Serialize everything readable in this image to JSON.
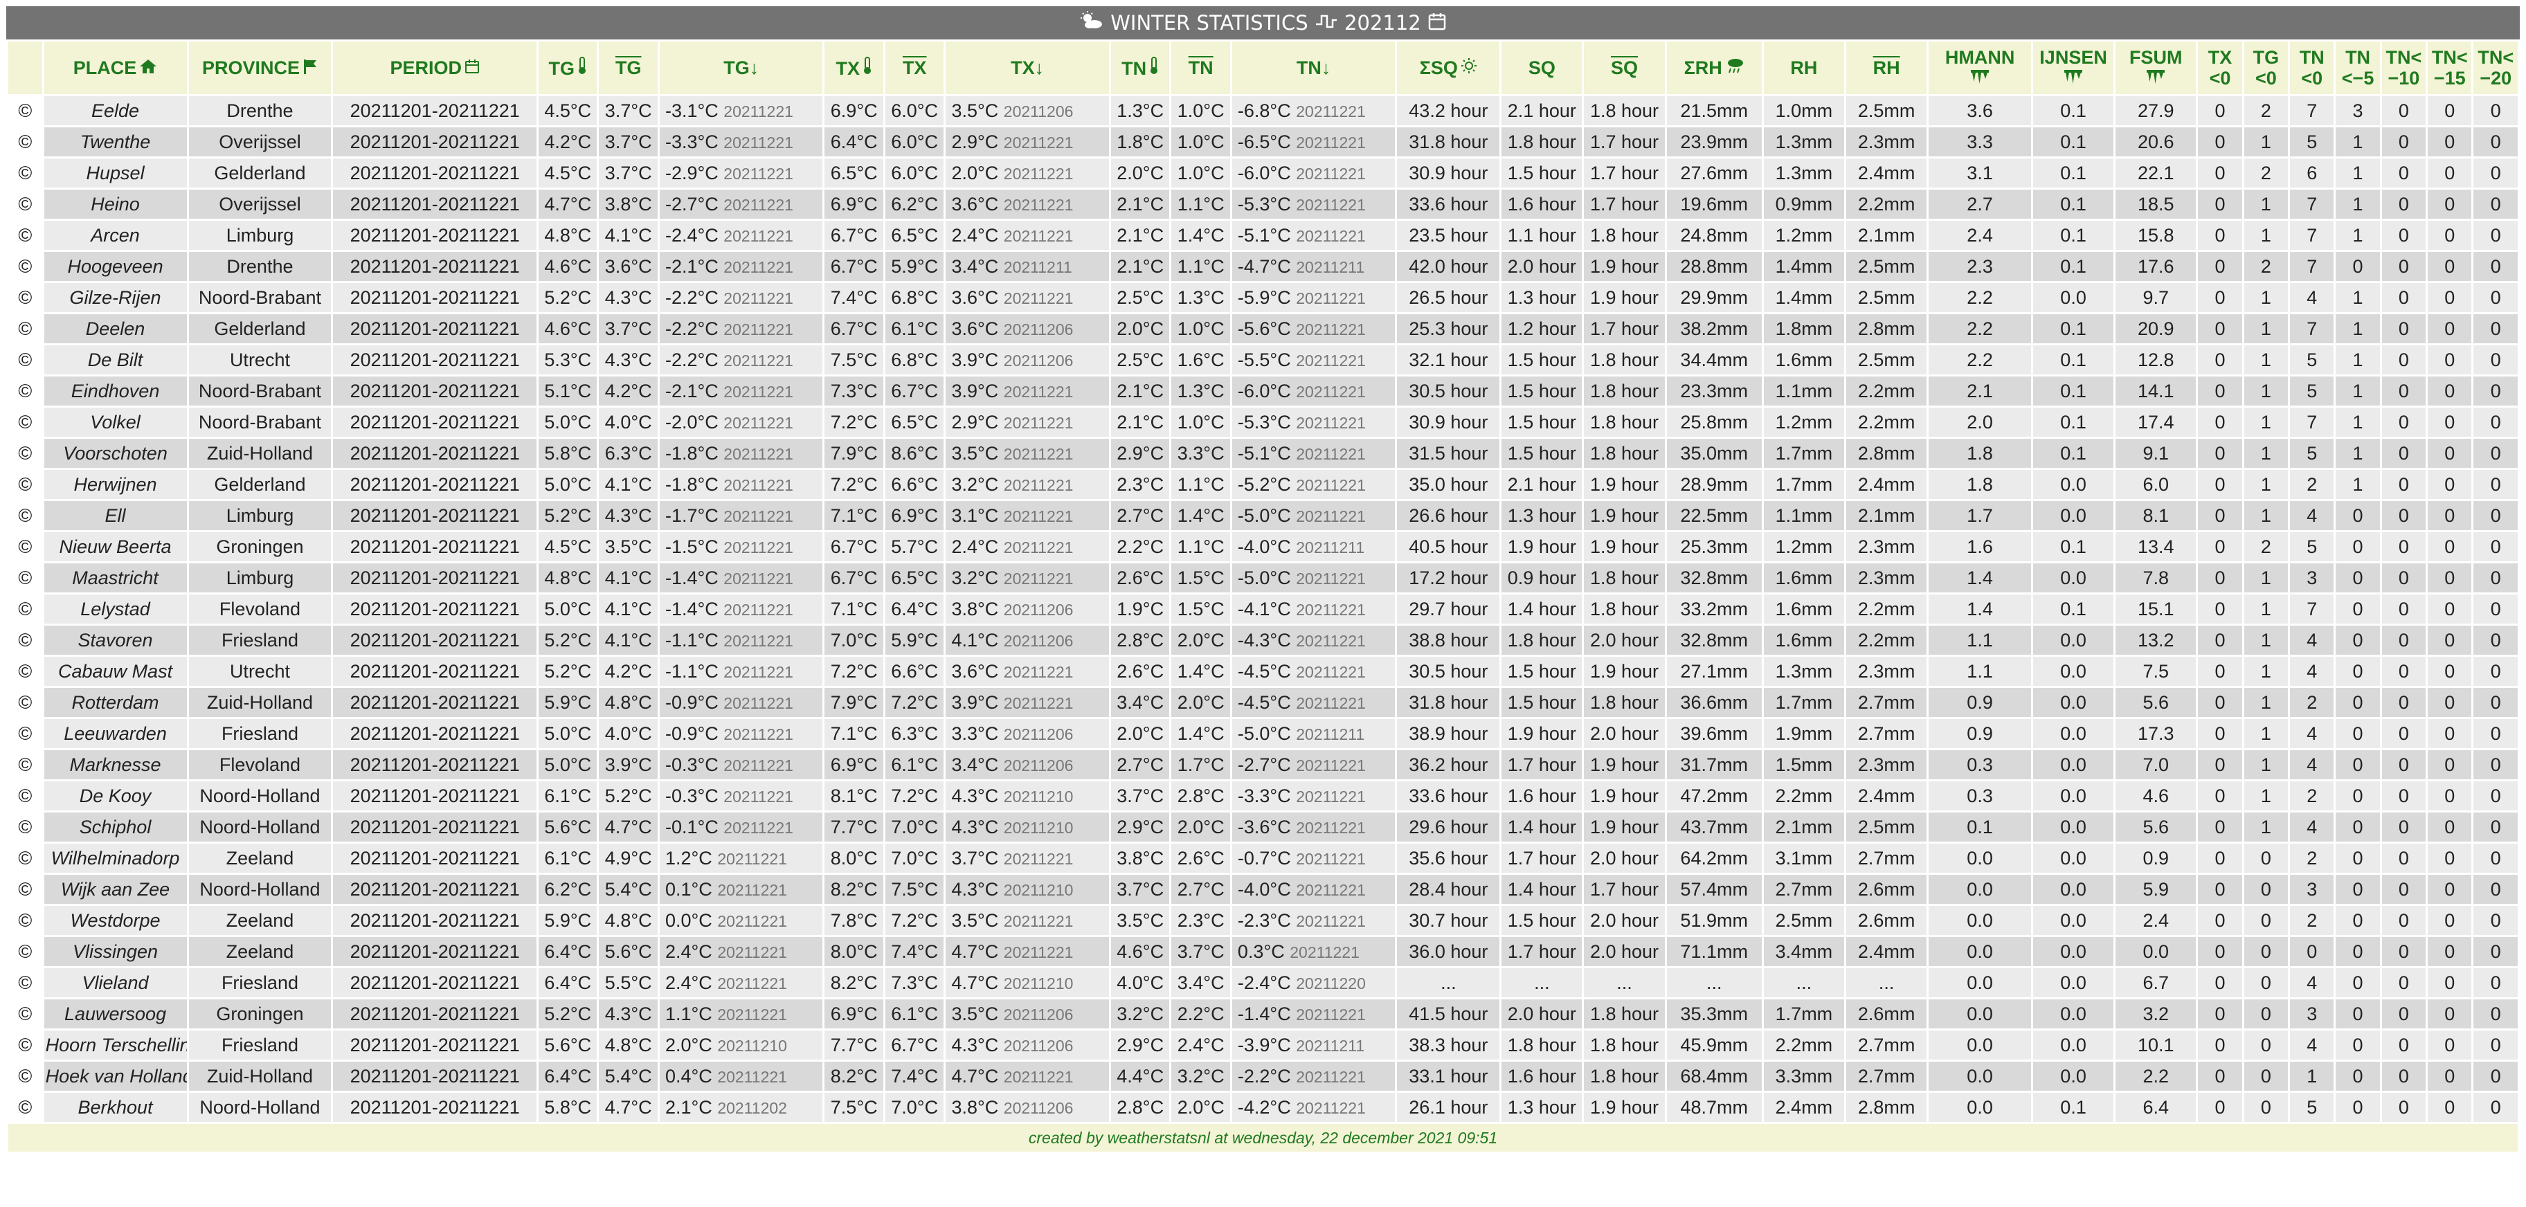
{
  "title": {
    "text": "WINTER STATISTICS",
    "period": "202112",
    "icons": [
      "sun-cloud-icon",
      "step-graph-icon",
      "calendar-icon"
    ]
  },
  "columns": [
    {
      "key": "c",
      "label": ""
    },
    {
      "key": "place",
      "label": "PLACE",
      "icon": "home-icon"
    },
    {
      "key": "province",
      "label": "PROVINCE",
      "icon": "flag-icon"
    },
    {
      "key": "period",
      "label": "PERIOD",
      "icon": "calendar-icon"
    },
    {
      "key": "tg",
      "label": "TG",
      "icon": "thermometer-icon"
    },
    {
      "key": "tg_avg",
      "label": "TG",
      "overline": true
    },
    {
      "key": "tg_low",
      "label": "TG↓"
    },
    {
      "key": "tx",
      "label": "TX",
      "icon": "thermometer-icon"
    },
    {
      "key": "tx_avg",
      "label": "TX",
      "overline": true
    },
    {
      "key": "tx_low",
      "label": "TX↓"
    },
    {
      "key": "tn",
      "label": "TN",
      "icon": "thermometer-icon"
    },
    {
      "key": "tn_avg",
      "label": "TN",
      "overline": true
    },
    {
      "key": "tn_low",
      "label": "TN↓"
    },
    {
      "key": "sq_sum",
      "label": "ΣSQ",
      "icon": "sun-icon"
    },
    {
      "key": "sq",
      "label": "SQ"
    },
    {
      "key": "sq_avg",
      "label": "SQ",
      "overline": true
    },
    {
      "key": "rh_sum",
      "label": "ΣRH",
      "icon": "rain-icon"
    },
    {
      "key": "rh",
      "label": "RH"
    },
    {
      "key": "rh_avg",
      "label": "RH",
      "overline": true
    },
    {
      "key": "hmann",
      "label": "HMANN",
      "icon": "icicle-icon"
    },
    {
      "key": "ijnsen",
      "label": "IJNSEN",
      "icon": "icicle-icon"
    },
    {
      "key": "fsum",
      "label": "FSUM",
      "icon": "icicle-icon"
    },
    {
      "key": "tx0",
      "label": "TX <0"
    },
    {
      "key": "tg0",
      "label": "TG <0"
    },
    {
      "key": "tn0",
      "label": "TN <0"
    },
    {
      "key": "tn5",
      "label": "TN <−5"
    },
    {
      "key": "tn10",
      "label": "TN< −10"
    },
    {
      "key": "tn15",
      "label": "TN< −15"
    },
    {
      "key": "tn20",
      "label": "TN< −20"
    }
  ],
  "rows": [
    [
      "©",
      "Eelde",
      "Drenthe",
      "20211201-20211221",
      "4.5°C",
      "3.7°C",
      "-3.1°C|20211221",
      "6.9°C",
      "6.0°C",
      "3.5°C|20211206",
      "1.3°C",
      "1.0°C",
      "-6.8°C|20211221",
      "43.2 hour",
      "2.1 hour",
      "1.8 hour",
      "21.5mm",
      "1.0mm",
      "2.5mm",
      "3.6",
      "0.1",
      "27.9",
      "0",
      "2",
      "7",
      "3",
      "0",
      "0",
      "0"
    ],
    [
      "©",
      "Twenthe",
      "Overijssel",
      "20211201-20211221",
      "4.2°C",
      "3.7°C",
      "-3.3°C|20211221",
      "6.4°C",
      "6.0°C",
      "2.9°C|20211221",
      "1.8°C",
      "1.0°C",
      "-6.5°C|20211221",
      "31.8 hour",
      "1.8 hour",
      "1.7 hour",
      "23.9mm",
      "1.3mm",
      "2.3mm",
      "3.3",
      "0.1",
      "20.6",
      "0",
      "1",
      "5",
      "1",
      "0",
      "0",
      "0"
    ],
    [
      "©",
      "Hupsel",
      "Gelderland",
      "20211201-20211221",
      "4.5°C",
      "3.7°C",
      "-2.9°C|20211221",
      "6.5°C",
      "6.0°C",
      "2.0°C|20211221",
      "2.0°C",
      "1.0°C",
      "-6.0°C|20211221",
      "30.9 hour",
      "1.5 hour",
      "1.7 hour",
      "27.6mm",
      "1.3mm",
      "2.4mm",
      "3.1",
      "0.1",
      "22.1",
      "0",
      "2",
      "6",
      "1",
      "0",
      "0",
      "0"
    ],
    [
      "©",
      "Heino",
      "Overijssel",
      "20211201-20211221",
      "4.7°C",
      "3.8°C",
      "-2.7°C|20211221",
      "6.9°C",
      "6.2°C",
      "3.6°C|20211221",
      "2.1°C",
      "1.1°C",
      "-5.3°C|20211221",
      "33.6 hour",
      "1.6 hour",
      "1.7 hour",
      "19.6mm",
      "0.9mm",
      "2.2mm",
      "2.7",
      "0.1",
      "18.5",
      "0",
      "1",
      "7",
      "1",
      "0",
      "0",
      "0"
    ],
    [
      "©",
      "Arcen",
      "Limburg",
      "20211201-20211221",
      "4.8°C",
      "4.1°C",
      "-2.4°C|20211221",
      "6.7°C",
      "6.5°C",
      "2.4°C|20211221",
      "2.1°C",
      "1.4°C",
      "-5.1°C|20211221",
      "23.5 hour",
      "1.1 hour",
      "1.8 hour",
      "24.8mm",
      "1.2mm",
      "2.1mm",
      "2.4",
      "0.1",
      "15.8",
      "0",
      "1",
      "7",
      "1",
      "0",
      "0",
      "0"
    ],
    [
      "©",
      "Hoogeveen",
      "Drenthe",
      "20211201-20211221",
      "4.6°C",
      "3.6°C",
      "-2.1°C|20211221",
      "6.7°C",
      "5.9°C",
      "3.4°C|20211211",
      "2.1°C",
      "1.1°C",
      "-4.7°C|20211211",
      "42.0 hour",
      "2.0 hour",
      "1.9 hour",
      "28.8mm",
      "1.4mm",
      "2.5mm",
      "2.3",
      "0.1",
      "17.6",
      "0",
      "2",
      "7",
      "0",
      "0",
      "0",
      "0"
    ],
    [
      "©",
      "Gilze-Rijen",
      "Noord-Brabant",
      "20211201-20211221",
      "5.2°C",
      "4.3°C",
      "-2.2°C|20211221",
      "7.4°C",
      "6.8°C",
      "3.6°C|20211221",
      "2.5°C",
      "1.3°C",
      "-5.9°C|20211221",
      "26.5 hour",
      "1.3 hour",
      "1.9 hour",
      "29.9mm",
      "1.4mm",
      "2.5mm",
      "2.2",
      "0.0",
      "9.7",
      "0",
      "1",
      "4",
      "1",
      "0",
      "0",
      "0"
    ],
    [
      "©",
      "Deelen",
      "Gelderland",
      "20211201-20211221",
      "4.6°C",
      "3.7°C",
      "-2.2°C|20211221",
      "6.7°C",
      "6.1°C",
      "3.6°C|20211206",
      "2.0°C",
      "1.0°C",
      "-5.6°C|20211221",
      "25.3 hour",
      "1.2 hour",
      "1.7 hour",
      "38.2mm",
      "1.8mm",
      "2.8mm",
      "2.2",
      "0.1",
      "20.9",
      "0",
      "1",
      "7",
      "1",
      "0",
      "0",
      "0"
    ],
    [
      "©",
      "De Bilt",
      "Utrecht",
      "20211201-20211221",
      "5.3°C",
      "4.3°C",
      "-2.2°C|20211221",
      "7.5°C",
      "6.8°C",
      "3.9°C|20211206",
      "2.5°C",
      "1.6°C",
      "-5.5°C|20211221",
      "32.1 hour",
      "1.5 hour",
      "1.8 hour",
      "34.4mm",
      "1.6mm",
      "2.5mm",
      "2.2",
      "0.1",
      "12.8",
      "0",
      "1",
      "5",
      "1",
      "0",
      "0",
      "0"
    ],
    [
      "©",
      "Eindhoven",
      "Noord-Brabant",
      "20211201-20211221",
      "5.1°C",
      "4.2°C",
      "-2.1°C|20211221",
      "7.3°C",
      "6.7°C",
      "3.9°C|20211221",
      "2.1°C",
      "1.3°C",
      "-6.0°C|20211221",
      "30.5 hour",
      "1.5 hour",
      "1.8 hour",
      "23.3mm",
      "1.1mm",
      "2.2mm",
      "2.1",
      "0.1",
      "14.1",
      "0",
      "1",
      "5",
      "1",
      "0",
      "0",
      "0"
    ],
    [
      "©",
      "Volkel",
      "Noord-Brabant",
      "20211201-20211221",
      "5.0°C",
      "4.0°C",
      "-2.0°C|20211221",
      "7.2°C",
      "6.5°C",
      "2.9°C|20211221",
      "2.1°C",
      "1.0°C",
      "-5.3°C|20211221",
      "30.9 hour",
      "1.5 hour",
      "1.8 hour",
      "25.8mm",
      "1.2mm",
      "2.2mm",
      "2.0",
      "0.1",
      "17.4",
      "0",
      "1",
      "7",
      "1",
      "0",
      "0",
      "0"
    ],
    [
      "©",
      "Voorschoten",
      "Zuid-Holland",
      "20211201-20211221",
      "5.8°C",
      "6.3°C",
      "-1.8°C|20211221",
      "7.9°C",
      "8.6°C",
      "3.5°C|20211221",
      "2.9°C",
      "3.3°C",
      "-5.1°C|20211221",
      "31.5 hour",
      "1.5 hour",
      "1.8 hour",
      "35.0mm",
      "1.7mm",
      "2.8mm",
      "1.8",
      "0.1",
      "9.1",
      "0",
      "1",
      "5",
      "1",
      "0",
      "0",
      "0"
    ],
    [
      "©",
      "Herwijnen",
      "Gelderland",
      "20211201-20211221",
      "5.0°C",
      "4.1°C",
      "-1.8°C|20211221",
      "7.2°C",
      "6.6°C",
      "3.2°C|20211221",
      "2.3°C",
      "1.1°C",
      "-5.2°C|20211221",
      "35.0 hour",
      "2.1 hour",
      "1.9 hour",
      "28.9mm",
      "1.7mm",
      "2.4mm",
      "1.8",
      "0.0",
      "6.0",
      "0",
      "1",
      "2",
      "1",
      "0",
      "0",
      "0"
    ],
    [
      "©",
      "Ell",
      "Limburg",
      "20211201-20211221",
      "5.2°C",
      "4.3°C",
      "-1.7°C|20211221",
      "7.1°C",
      "6.9°C",
      "3.1°C|20211221",
      "2.7°C",
      "1.4°C",
      "-5.0°C|20211221",
      "26.6 hour",
      "1.3 hour",
      "1.9 hour",
      "22.5mm",
      "1.1mm",
      "2.1mm",
      "1.7",
      "0.0",
      "8.1",
      "0",
      "1",
      "4",
      "0",
      "0",
      "0",
      "0"
    ],
    [
      "©",
      "Nieuw Beerta",
      "Groningen",
      "20211201-20211221",
      "4.5°C",
      "3.5°C",
      "-1.5°C|20211221",
      "6.7°C",
      "5.7°C",
      "2.4°C|20211221",
      "2.2°C",
      "1.1°C",
      "-4.0°C|20211211",
      "40.5 hour",
      "1.9 hour",
      "1.9 hour",
      "25.3mm",
      "1.2mm",
      "2.3mm",
      "1.6",
      "0.1",
      "13.4",
      "0",
      "2",
      "5",
      "0",
      "0",
      "0",
      "0"
    ],
    [
      "©",
      "Maastricht",
      "Limburg",
      "20211201-20211221",
      "4.8°C",
      "4.1°C",
      "-1.4°C|20211221",
      "6.7°C",
      "6.5°C",
      "3.2°C|20211221",
      "2.6°C",
      "1.5°C",
      "-5.0°C|20211221",
      "17.2 hour",
      "0.9 hour",
      "1.8 hour",
      "32.8mm",
      "1.6mm",
      "2.3mm",
      "1.4",
      "0.0",
      "7.8",
      "0",
      "1",
      "3",
      "0",
      "0",
      "0",
      "0"
    ],
    [
      "©",
      "Lelystad",
      "Flevoland",
      "20211201-20211221",
      "5.0°C",
      "4.1°C",
      "-1.4°C|20211221",
      "7.1°C",
      "6.4°C",
      "3.8°C|20211206",
      "1.9°C",
      "1.5°C",
      "-4.1°C|20211221",
      "29.7 hour",
      "1.4 hour",
      "1.8 hour",
      "33.2mm",
      "1.6mm",
      "2.2mm",
      "1.4",
      "0.1",
      "15.1",
      "0",
      "1",
      "7",
      "0",
      "0",
      "0",
      "0"
    ],
    [
      "©",
      "Stavoren",
      "Friesland",
      "20211201-20211221",
      "5.2°C",
      "4.1°C",
      "-1.1°C|20211221",
      "7.0°C",
      "5.9°C",
      "4.1°C|20211206",
      "2.8°C",
      "2.0°C",
      "-4.3°C|20211221",
      "38.8 hour",
      "1.8 hour",
      "2.0 hour",
      "32.8mm",
      "1.6mm",
      "2.2mm",
      "1.1",
      "0.0",
      "13.2",
      "0",
      "1",
      "4",
      "0",
      "0",
      "0",
      "0"
    ],
    [
      "©",
      "Cabauw Mast",
      "Utrecht",
      "20211201-20211221",
      "5.2°C",
      "4.2°C",
      "-1.1°C|20211221",
      "7.2°C",
      "6.6°C",
      "3.6°C|20211221",
      "2.6°C",
      "1.4°C",
      "-4.5°C|20211221",
      "30.5 hour",
      "1.5 hour",
      "1.9 hour",
      "27.1mm",
      "1.3mm",
      "2.3mm",
      "1.1",
      "0.0",
      "7.5",
      "0",
      "1",
      "4",
      "0",
      "0",
      "0",
      "0"
    ],
    [
      "©",
      "Rotterdam",
      "Zuid-Holland",
      "20211201-20211221",
      "5.9°C",
      "4.8°C",
      "-0.9°C|20211221",
      "7.9°C",
      "7.2°C",
      "3.9°C|20211221",
      "3.4°C",
      "2.0°C",
      "-4.5°C|20211221",
      "31.8 hour",
      "1.5 hour",
      "1.8 hour",
      "36.6mm",
      "1.7mm",
      "2.7mm",
      "0.9",
      "0.0",
      "5.6",
      "0",
      "1",
      "2",
      "0",
      "0",
      "0",
      "0"
    ],
    [
      "©",
      "Leeuwarden",
      "Friesland",
      "20211201-20211221",
      "5.0°C",
      "4.0°C",
      "-0.9°C|20211221",
      "7.1°C",
      "6.3°C",
      "3.3°C|20211206",
      "2.0°C",
      "1.4°C",
      "-5.0°C|20211211",
      "38.9 hour",
      "1.9 hour",
      "2.0 hour",
      "39.6mm",
      "1.9mm",
      "2.7mm",
      "0.9",
      "0.0",
      "17.3",
      "0",
      "1",
      "4",
      "0",
      "0",
      "0",
      "0"
    ],
    [
      "©",
      "Marknesse",
      "Flevoland",
      "20211201-20211221",
      "5.0°C",
      "3.9°C",
      "-0.3°C|20211221",
      "6.9°C",
      "6.1°C",
      "3.4°C|20211206",
      "2.7°C",
      "1.7°C",
      "-2.7°C|20211221",
      "36.2 hour",
      "1.7 hour",
      "1.9 hour",
      "31.7mm",
      "1.5mm",
      "2.3mm",
      "0.3",
      "0.0",
      "7.0",
      "0",
      "1",
      "4",
      "0",
      "0",
      "0",
      "0"
    ],
    [
      "©",
      "De Kooy",
      "Noord-Holland",
      "20211201-20211221",
      "6.1°C",
      "5.2°C",
      "-0.3°C|20211221",
      "8.1°C",
      "7.2°C",
      "4.3°C|20211210",
      "3.7°C",
      "2.8°C",
      "-3.3°C|20211221",
      "33.6 hour",
      "1.6 hour",
      "1.9 hour",
      "47.2mm",
      "2.2mm",
      "2.4mm",
      "0.3",
      "0.0",
      "4.6",
      "0",
      "1",
      "2",
      "0",
      "0",
      "0",
      "0"
    ],
    [
      "©",
      "Schiphol",
      "Noord-Holland",
      "20211201-20211221",
      "5.6°C",
      "4.7°C",
      "-0.1°C|20211221",
      "7.7°C",
      "7.0°C",
      "4.3°C|20211210",
      "2.9°C",
      "2.0°C",
      "-3.6°C|20211221",
      "29.6 hour",
      "1.4 hour",
      "1.9 hour",
      "43.7mm",
      "2.1mm",
      "2.5mm",
      "0.1",
      "0.0",
      "5.6",
      "0",
      "1",
      "4",
      "0",
      "0",
      "0",
      "0"
    ],
    [
      "©",
      "Wilhelminadorp",
      "Zeeland",
      "20211201-20211221",
      "6.1°C",
      "4.9°C",
      "1.2°C|20211221",
      "8.0°C",
      "7.0°C",
      "3.7°C|20211221",
      "3.8°C",
      "2.6°C",
      "-0.7°C|20211221",
      "35.6 hour",
      "1.7 hour",
      "2.0 hour",
      "64.2mm",
      "3.1mm",
      "2.7mm",
      "0.0",
      "0.0",
      "0.9",
      "0",
      "0",
      "2",
      "0",
      "0",
      "0",
      "0"
    ],
    [
      "©",
      "Wijk aan Zee",
      "Noord-Holland",
      "20211201-20211221",
      "6.2°C",
      "5.4°C",
      "0.1°C|20211221",
      "8.2°C",
      "7.5°C",
      "4.3°C|20211210",
      "3.7°C",
      "2.7°C",
      "-4.0°C|20211221",
      "28.4 hour",
      "1.4 hour",
      "1.7 hour",
      "57.4mm",
      "2.7mm",
      "2.6mm",
      "0.0",
      "0.0",
      "5.9",
      "0",
      "0",
      "3",
      "0",
      "0",
      "0",
      "0"
    ],
    [
      "©",
      "Westdorpe",
      "Zeeland",
      "20211201-20211221",
      "5.9°C",
      "4.8°C",
      "0.0°C|20211221",
      "7.8°C",
      "7.2°C",
      "3.5°C|20211221",
      "3.5°C",
      "2.3°C",
      "-2.3°C|20211221",
      "30.7 hour",
      "1.5 hour",
      "2.0 hour",
      "51.9mm",
      "2.5mm",
      "2.6mm",
      "0.0",
      "0.0",
      "2.4",
      "0",
      "0",
      "2",
      "0",
      "0",
      "0",
      "0"
    ],
    [
      "©",
      "Vlissingen",
      "Zeeland",
      "20211201-20211221",
      "6.4°C",
      "5.6°C",
      "2.4°C|20211221",
      "8.0°C",
      "7.4°C",
      "4.7°C|20211221",
      "4.6°C",
      "3.7°C",
      "0.3°C|20211221",
      "36.0 hour",
      "1.7 hour",
      "2.0 hour",
      "71.1mm",
      "3.4mm",
      "2.4mm",
      "0.0",
      "0.0",
      "0.0",
      "0",
      "0",
      "0",
      "0",
      "0",
      "0",
      "0"
    ],
    [
      "©",
      "Vlieland",
      "Friesland",
      "20211201-20211221",
      "6.4°C",
      "5.5°C",
      "2.4°C|20211221",
      "8.2°C",
      "7.3°C",
      "4.7°C|20211210",
      "4.0°C",
      "3.4°C",
      "-2.4°C|20211220",
      "...",
      "...",
      "...",
      "...",
      "...",
      "...",
      "0.0",
      "0.0",
      "6.7",
      "0",
      "0",
      "4",
      "0",
      "0",
      "0",
      "0"
    ],
    [
      "©",
      "Lauwersoog",
      "Groningen",
      "20211201-20211221",
      "5.2°C",
      "4.3°C",
      "1.1°C|20211221",
      "6.9°C",
      "6.1°C",
      "3.5°C|20211206",
      "3.2°C",
      "2.2°C",
      "-1.4°C|20211221",
      "41.5 hour",
      "2.0 hour",
      "1.8 hour",
      "35.3mm",
      "1.7mm",
      "2.6mm",
      "0.0",
      "0.0",
      "3.2",
      "0",
      "0",
      "3",
      "0",
      "0",
      "0",
      "0"
    ],
    [
      "©",
      "Hoorn Terschelling",
      "Friesland",
      "20211201-20211221",
      "5.6°C",
      "4.8°C",
      "2.0°C|20211210",
      "7.7°C",
      "6.7°C",
      "4.3°C|20211206",
      "2.9°C",
      "2.4°C",
      "-3.9°C|20211211",
      "38.3 hour",
      "1.8 hour",
      "1.8 hour",
      "45.9mm",
      "2.2mm",
      "2.7mm",
      "0.0",
      "0.0",
      "10.1",
      "0",
      "0",
      "4",
      "0",
      "0",
      "0",
      "0"
    ],
    [
      "©",
      "Hoek van Holland",
      "Zuid-Holland",
      "20211201-20211221",
      "6.4°C",
      "5.4°C",
      "0.4°C|20211221",
      "8.2°C",
      "7.4°C",
      "4.7°C|20211221",
      "4.4°C",
      "3.2°C",
      "-2.2°C|20211221",
      "33.1 hour",
      "1.6 hour",
      "1.8 hour",
      "68.4mm",
      "3.3mm",
      "2.7mm",
      "0.0",
      "0.0",
      "2.2",
      "0",
      "0",
      "1",
      "0",
      "0",
      "0",
      "0"
    ],
    [
      "©",
      "Berkhout",
      "Noord-Holland",
      "20211201-20211221",
      "5.8°C",
      "4.7°C",
      "2.1°C|20211202",
      "7.5°C",
      "7.0°C",
      "3.8°C|20211206",
      "2.8°C",
      "2.0°C",
      "-4.2°C|20211221",
      "26.1 hour",
      "1.3 hour",
      "1.9 hour",
      "48.7mm",
      "2.4mm",
      "2.8mm",
      "0.0",
      "0.1",
      "6.4",
      "0",
      "0",
      "5",
      "0",
      "0",
      "0",
      "0"
    ]
  ],
  "footer": "created by weatherstatsnl at wednesday, 22 december 2021 09:51",
  "colors": {
    "header_bg": "#f3f3d6",
    "header_text": "#1f7a1f",
    "title_bg": "#737373",
    "row_odd": "#ebebeb",
    "row_even": "#d9d9d9"
  }
}
